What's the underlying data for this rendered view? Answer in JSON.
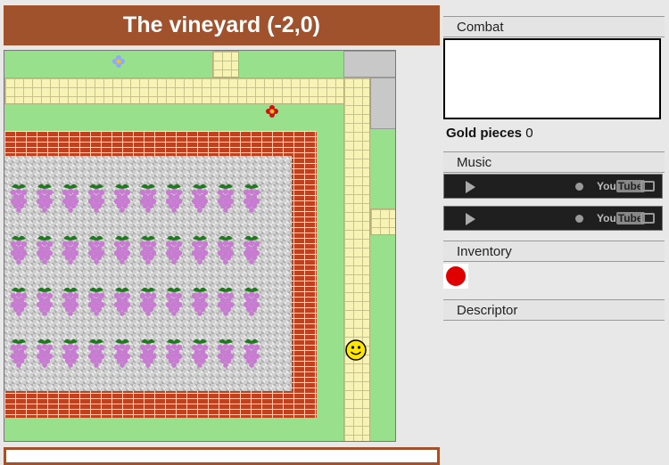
{
  "title": "The vineyard (-2,0)",
  "combat": {
    "label": "Combat"
  },
  "gold": {
    "label": "Gold pieces",
    "value": "0"
  },
  "music": {
    "label": "Music",
    "players": [
      {
        "brand": "YouTube",
        "icon": "play-icon"
      },
      {
        "brand": "YouTube",
        "icon": "play-icon"
      }
    ]
  },
  "inventory": {
    "label": "Inventory",
    "items": [
      {
        "icon": "red-orb",
        "color": "#e00000"
      }
    ]
  },
  "descriptor": {
    "label": "Descriptor"
  },
  "map": {
    "grass_color": "#98e08c",
    "path_color": "#f7f3b4",
    "brick_color": "#c0411f",
    "grape_rows": 4,
    "grapes_per_row": 10,
    "grape_color": "#c77bd1",
    "leaf_color": "#1f7a1f",
    "player_icon": "smiley-face",
    "flowers": [
      "blue-flower",
      "red-flower"
    ]
  },
  "colors": {
    "title_bg": "#a0522d",
    "title_text": "#ffffff"
  }
}
